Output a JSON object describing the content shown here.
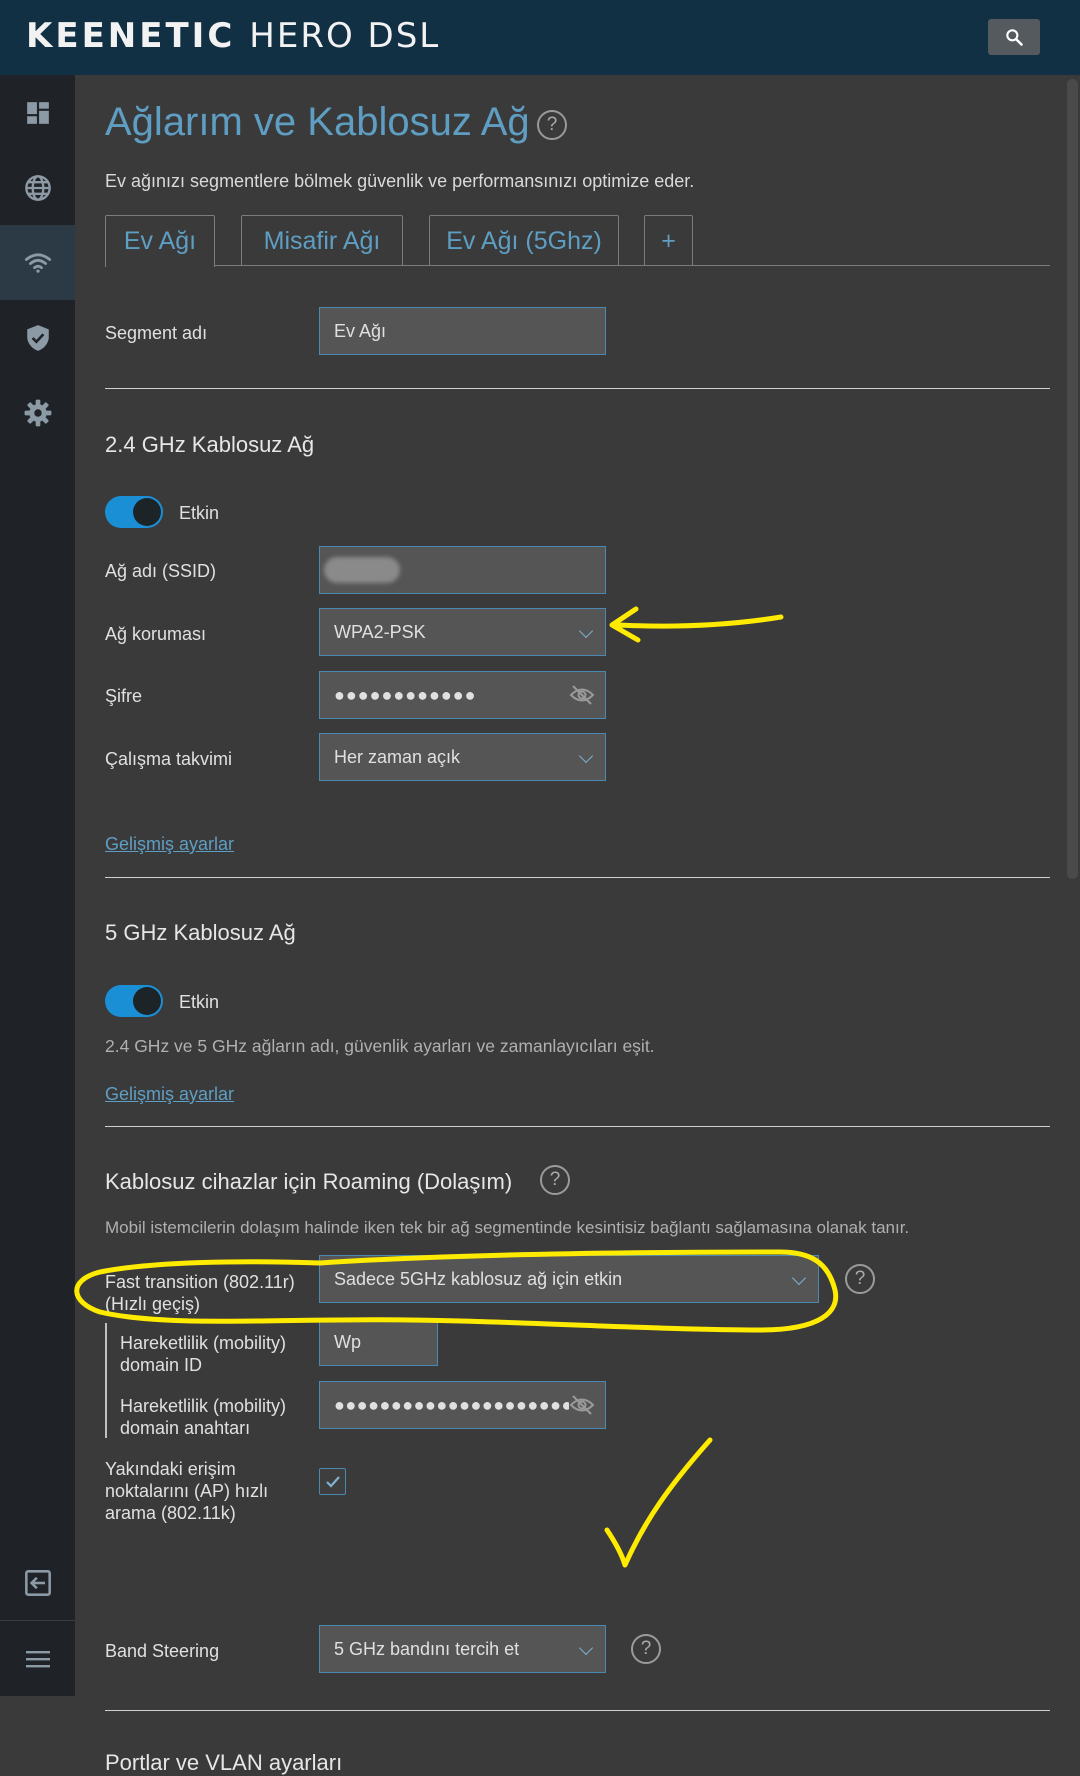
{
  "header": {
    "brand": "KEENETIC",
    "model": "HERO DSL",
    "search_icon": "search-icon"
  },
  "sidebar": {
    "items": [
      {
        "icon": "dashboard-icon"
      },
      {
        "icon": "globe-icon"
      },
      {
        "icon": "wifi-icon",
        "active": true
      },
      {
        "icon": "shield-icon"
      },
      {
        "icon": "gear-icon"
      }
    ],
    "bottom": [
      {
        "icon": "logout-icon"
      },
      {
        "icon": "menu-icon"
      }
    ]
  },
  "page": {
    "title": "Ağlarım ve Kablosuz Ağ",
    "help": "?",
    "subtitle": "Ev ağınızı segmentlere bölmek güvenlik ve performansınızı optimize eder."
  },
  "tabs": [
    {
      "label": "Ev Ağı",
      "active": true
    },
    {
      "label": "Misafir Ağı"
    },
    {
      "label": "Ev Ağı (5Ghz)"
    },
    {
      "label": "+"
    }
  ],
  "segment": {
    "label": "Segment adı",
    "value": "Ev Ağı"
  },
  "wifi24": {
    "title": "2.4 GHz Kablosuz Ağ",
    "enabled_label": "Etkin",
    "enabled": true,
    "ssid_label": "Ağ adı (SSID)",
    "ssid_value": "",
    "security_label": "Ağ koruması",
    "security_value": "WPA2-PSK",
    "password_label": "Şifre",
    "password_value": "●●●●●●●●●●●●",
    "schedule_label": "Çalışma takvimi",
    "schedule_value": "Her zaman açık",
    "advanced_link": "Gelişmiş ayarlar"
  },
  "wifi5": {
    "title": "5 GHz Kablosuz Ağ",
    "enabled_label": "Etkin",
    "enabled": true,
    "note": "2.4 GHz ve 5 GHz ağların adı, güvenlik ayarları ve zamanlayıcıları eşit.",
    "advanced_link": "Gelişmiş ayarlar"
  },
  "roaming": {
    "title": "Kablosuz cihazlar için Roaming (Dolaşım)",
    "help": "?",
    "description": "Mobil istemcilerin dolaşım halinde iken tek bir ağ segmentinde kesintisiz bağlantı sağlamasına olanak tanır.",
    "ft_label_line1": "Fast transition (802.11r)",
    "ft_label_line2": "(Hızlı geçiş)",
    "ft_value": "Sadece 5GHz kablosuz ağ için etkin",
    "mobility_id_label_line1": "Hareketlilik (mobility)",
    "mobility_id_label_line2": "domain ID",
    "mobility_id_value": "Wp",
    "mobility_key_label_line1": "Hareketlilik (mobility)",
    "mobility_key_label_line2": "domain anahtarı",
    "mobility_key_value": "●●●●●●●●●●●●●●●●●●●●●",
    "k_label_line1": "Yakındaki erişim",
    "k_label_line2": "noktalarını (AP) hızlı",
    "k_label_line3": "arama (802.11k)",
    "k_checked": true,
    "band_label": "Band Steering",
    "band_value": "5 GHz bandını tercih et"
  },
  "ports": {
    "title": "Portlar ve VLAN ayarları"
  },
  "colors": {
    "accent": "#5f9ec3",
    "topbar": "#123044",
    "sidebar": "#1f2327",
    "background": "#3a3a3a",
    "toggle_on": "#1b8fd6",
    "annotation": "#ffeb00"
  }
}
